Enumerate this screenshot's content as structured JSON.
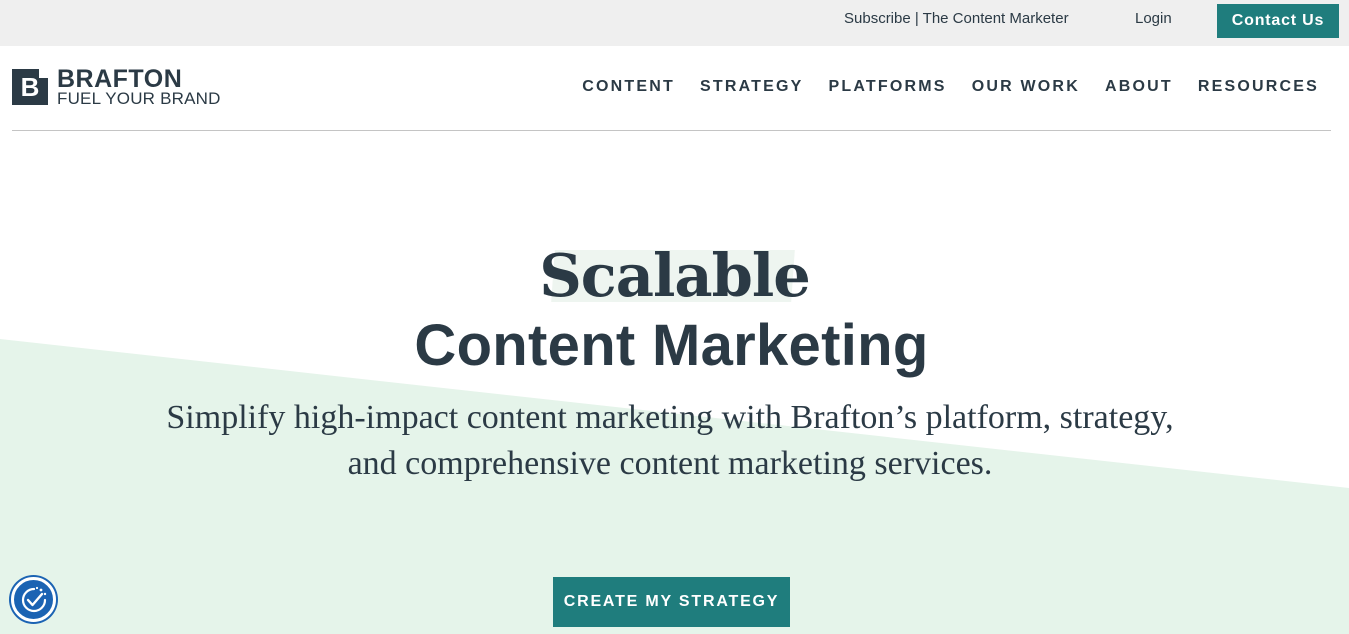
{
  "utility_bar": {
    "subscribe_label": "Subscribe | The Content Marketer",
    "login_label": "Login",
    "contact_label": "Contact Us"
  },
  "header": {
    "logo_mark": "B",
    "logo_name": "BRAFTON",
    "logo_tagline": "FUEL YOUR BRAND",
    "nav": [
      {
        "label": "CONTENT"
      },
      {
        "label": "STRATEGY"
      },
      {
        "label": "PLATFORMS"
      },
      {
        "label": "OUR WORK"
      },
      {
        "label": "ABOUT"
      },
      {
        "label": "RESOURCES"
      }
    ]
  },
  "hero": {
    "title_line1": "Scalable",
    "title_line2": "Content Marketing",
    "subtitle_line1": "Simplify high-impact content marketing with Brafton’s platform, strategy,",
    "subtitle_line2": "and comprehensive content marketing services.",
    "cta_label": "CREATE MY STRATEGY"
  },
  "icons": {
    "accessibility": "accessibility-check-icon"
  },
  "colors": {
    "accent": "#1f7d7d",
    "text": "#2b3a45",
    "hero_band": "#e5f4ea",
    "utility_bg": "#efefef",
    "accessibility_blue": "#1b63b3"
  }
}
